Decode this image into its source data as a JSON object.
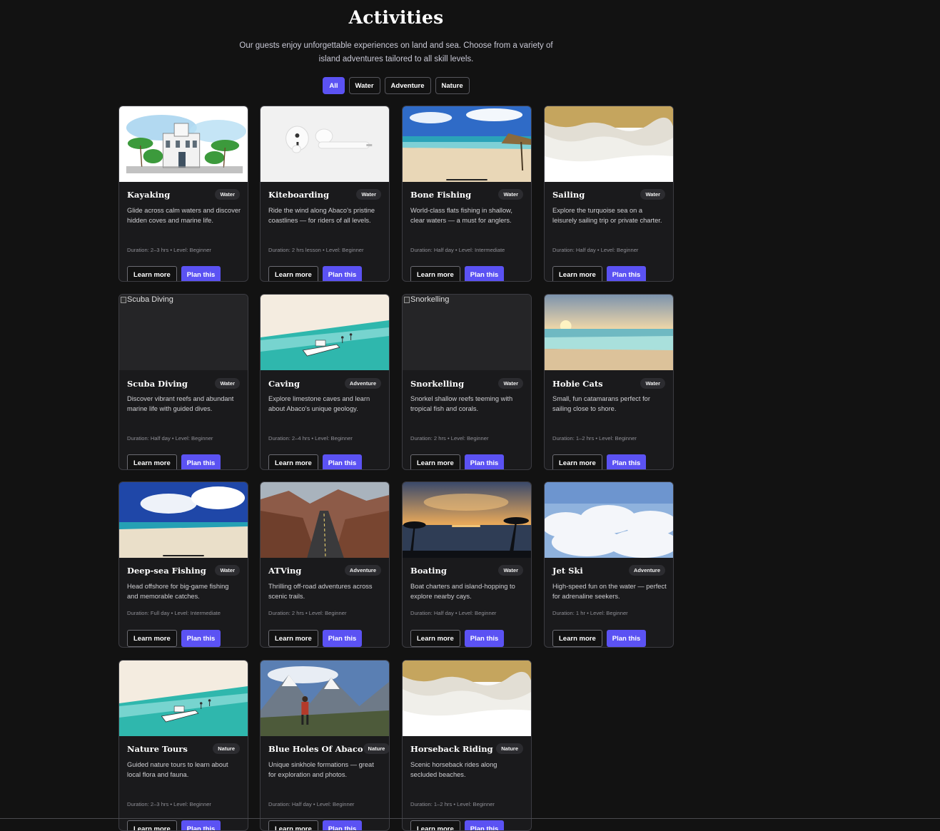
{
  "page": {
    "title": "Activities",
    "intro": "Our guests enjoy unforgettable experiences on land and sea. Choose from a variety of island adventures tailored to all skill levels."
  },
  "filters": [
    {
      "label": "All",
      "active": true
    },
    {
      "label": "Water",
      "active": false
    },
    {
      "label": "Adventure",
      "active": false
    },
    {
      "label": "Nature",
      "active": false
    }
  ],
  "colors": {
    "background": "#121212",
    "card": "#1a1a1c",
    "accent": "#5b52f3",
    "border": "#3c3c42"
  },
  "buttons": {
    "learn_more": "Learn more",
    "plan": "Plan this"
  },
  "activities": [
    {
      "title": "Kayaking",
      "tag": "Water",
      "desc": "Glide across calm waters and discover hidden coves and marine life.",
      "duration": "Duration: 2–3 hrs",
      "level": "Level: Beginner",
      "image": "resort-sketch"
    },
    {
      "title": "Kiteboarding",
      "tag": "Water",
      "desc": "Ride the wind along Abaco's pristine coastlines — for riders of all levels.",
      "duration": "Duration: 2 hrs lesson",
      "level": "Level: Beginner",
      "image": "earbuds"
    },
    {
      "title": "Bone Fishing",
      "tag": "Water",
      "desc": "World-class flats fishing in shallow, clear waters — a must for anglers.",
      "duration": "Duration: Half day",
      "level": "Level: Intermediate",
      "image": "beach-umbrella"
    },
    {
      "title": "Sailing",
      "tag": "Water",
      "desc": "Explore the turquoise sea on a leisurely sailing trip or private charter.",
      "duration": "Duration: Half day",
      "level": "Level: Beginner",
      "image": "sand-waves"
    },
    {
      "title": "Scuba Diving",
      "tag": "Water",
      "desc": "Discover vibrant reefs and abundant marine life with guided dives.",
      "duration": "Duration: Half day",
      "level": "Level: Beginner",
      "image": "broken",
      "alt": "Scuba Diving"
    },
    {
      "title": "Caving",
      "tag": "Adventure",
      "desc": "Explore limestone caves and learn about Abaco's unique geology.",
      "duration": "Duration: 2–4 hrs",
      "level": "Level: Beginner",
      "image": "boat-sandbar"
    },
    {
      "title": "Snorkelling",
      "tag": "Water",
      "desc": "Snorkel shallow reefs teeming with tropical fish and corals.",
      "duration": "Duration: 2 hrs",
      "level": "Level: Beginner",
      "image": "broken",
      "alt": "Snorkelling"
    },
    {
      "title": "Hobie Cats",
      "tag": "Water",
      "desc": "Small, fun catamarans perfect for sailing close to shore.",
      "duration": "Duration: 1–2 hrs",
      "level": "Level: Beginner",
      "image": "sunset-shore"
    },
    {
      "title": "Deep-sea Fishing",
      "tag": "Water",
      "desc": "Head offshore for big-game fishing and memorable catches.",
      "duration": "Duration: Full day",
      "level": "Level: Intermediate",
      "image": "beach-sky"
    },
    {
      "title": "ATVing",
      "tag": "Adventure",
      "desc": "Thrilling off-road adventures across scenic trails.",
      "duration": "Duration: 2 hrs",
      "level": "Level: Beginner",
      "image": "canyon-road"
    },
    {
      "title": "Boating",
      "tag": "Water",
      "desc": "Boat charters and island-hopping to explore nearby cays.",
      "duration": "Duration: Half day",
      "level": "Level: Beginner",
      "image": "palm-sunset"
    },
    {
      "title": "Jet Ski",
      "tag": "Adventure",
      "desc": "High-speed fun on the water — perfect for adrenaline seekers.",
      "duration": "Duration: 1 hr",
      "level": "Level: Beginner",
      "image": "clouds"
    },
    {
      "title": "Nature Tours",
      "tag": "Nature",
      "desc": "Guided nature tours to learn about local flora and fauna.",
      "duration": "Duration: 2–3 hrs",
      "level": "Level: Beginner",
      "image": "boat-sandbar"
    },
    {
      "title": "Blue Holes Of Abaco",
      "tag": "Nature",
      "desc": "Unique sinkhole formations — great for exploration and photos.",
      "duration": "Duration: Half day",
      "level": "Level: Beginner",
      "image": "mountain-hiker"
    },
    {
      "title": "Horseback Riding",
      "tag": "Nature",
      "desc": "Scenic horseback rides along secluded beaches.",
      "duration": "Duration: 1–2 hrs",
      "level": "Level: Beginner",
      "image": "sand-waves"
    }
  ]
}
